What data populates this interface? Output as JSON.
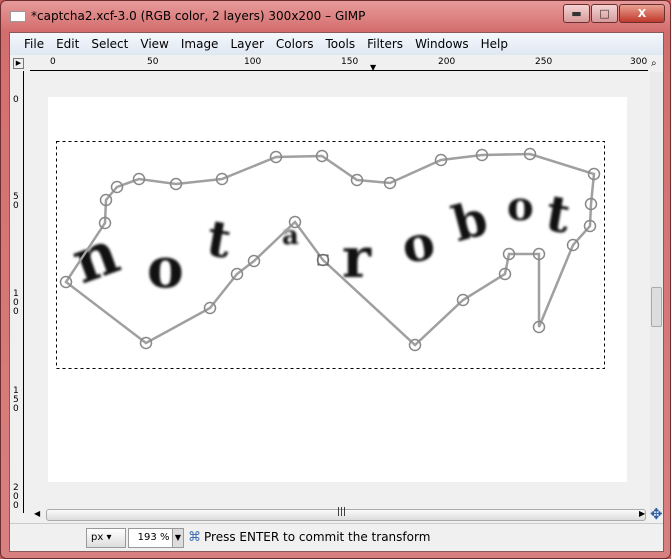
{
  "window": {
    "title": "*captcha2.xcf-3.0 (RGB color, 2 layers) 300x200 – GIMP",
    "minimize": "▬",
    "maximize": "□",
    "close": "X"
  },
  "menu": [
    {
      "label": "File"
    },
    {
      "label": "Edit"
    },
    {
      "label": "Select"
    },
    {
      "label": "View"
    },
    {
      "label": "Image"
    },
    {
      "label": "Layer"
    },
    {
      "label": "Colors"
    },
    {
      "label": "Tools"
    },
    {
      "label": "Filters"
    },
    {
      "label": "Windows"
    },
    {
      "label": "Help"
    }
  ],
  "hruler": [
    "0",
    "50",
    "100",
    "150",
    "200",
    "250",
    "300"
  ],
  "vruler": [
    "0",
    "5\n0",
    "1\n0\n0",
    "1\n5\n0",
    "2\n0\n0"
  ],
  "canvas": {
    "letters": [
      "n",
      "o",
      "t",
      "a",
      "r",
      "o",
      "b",
      "o",
      "t"
    ]
  },
  "status": {
    "unit": "px",
    "zoom": "193 %",
    "message": "Press ENTER to commit the transform"
  },
  "colors": {
    "titlebar": "#d46e6e",
    "cage": "#a0a0a0"
  }
}
